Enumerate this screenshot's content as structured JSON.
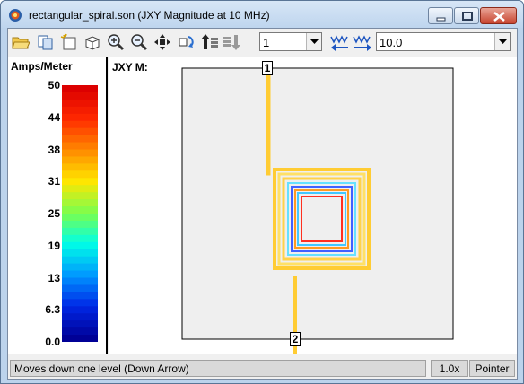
{
  "window": {
    "title": "rectangular_spiral.son (JXY Magnitude at 10 MHz)"
  },
  "toolbar": {
    "icons": [
      "open-folder-icon",
      "copy-icon",
      "new-view-icon",
      "3d-box-icon",
      "zoom-in-icon",
      "zoom-out-icon",
      "pan-icon",
      "rotate-icon",
      "level-up-icon",
      "level-down-icon",
      "frequency-down-icon",
      "frequency-up-icon"
    ],
    "level_value": "1",
    "frequency_value": "10.0"
  },
  "legend": {
    "title": "Amps/Meter",
    "ticks": [
      "50",
      "44",
      "38",
      "31",
      "25",
      "19",
      "13",
      "6.3",
      "0.0"
    ]
  },
  "plot": {
    "label": "JXY M:",
    "port_1": "1",
    "port_2": "2",
    "colors": {
      "outer_trace": "#ffcc33",
      "background": "#efefef"
    }
  },
  "status": {
    "message": "Moves down one level (Down Arrow)",
    "zoom": "1.0x",
    "mode": "Pointer"
  }
}
